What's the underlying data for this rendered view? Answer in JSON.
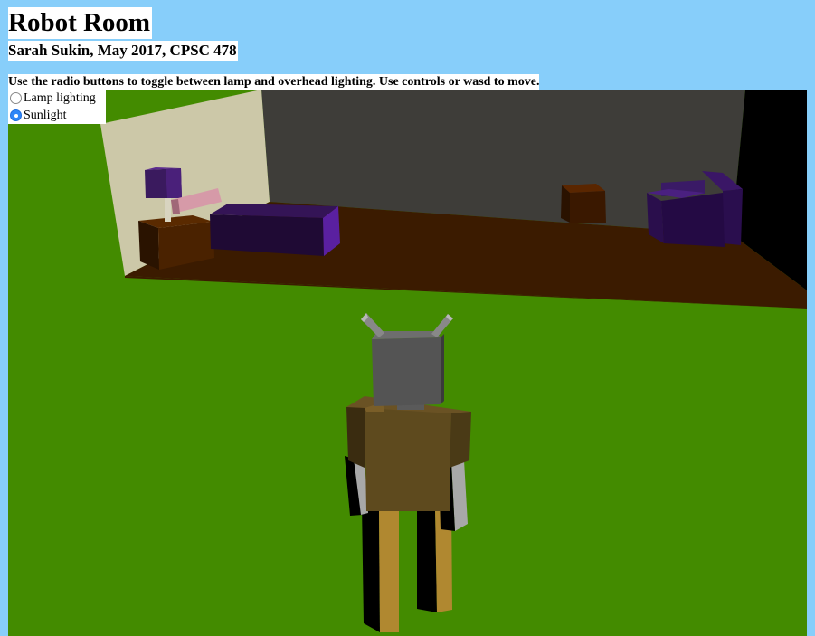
{
  "page": {
    "title": "Robot Room",
    "subtitle": "Sarah Sukin, May 2017, CPSC 478",
    "instructions": "Use the radio buttons to toggle between lamp and overhead lighting. Use controls or wasd to move."
  },
  "lighting": {
    "options": [
      {
        "label": "Lamp lighting",
        "selected": false
      },
      {
        "label": "Sunlight",
        "selected": true
      }
    ]
  },
  "colors": {
    "sky": "#87cefa",
    "grass": "#438b00",
    "floor": "#3b1b00",
    "back_wall": "#3e3d39",
    "side_wall": "#ccc8a8",
    "couch": "#2e0e4e",
    "robot_body": "#5e4a1e",
    "robot_head": "#545454",
    "robot_legs": "#b08830",
    "radio_accent": "#2f86f7"
  }
}
